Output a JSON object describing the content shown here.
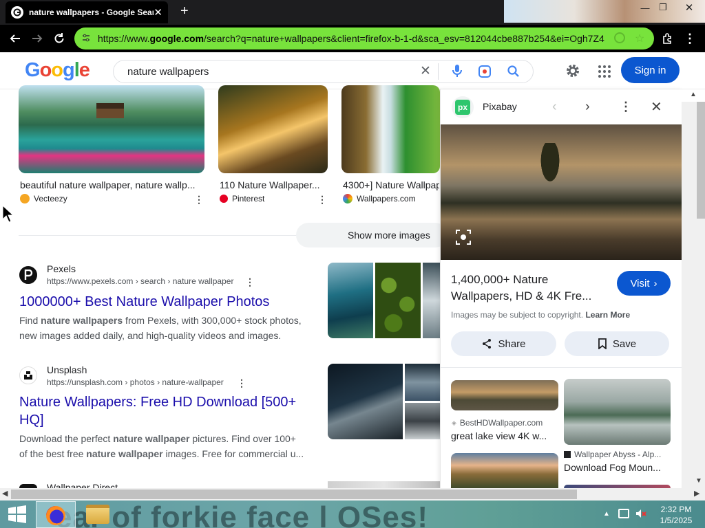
{
  "browser": {
    "tab_title": "nature wallpapers - Google Search",
    "url_prefix": "https://www.",
    "url_domain": "google.com",
    "url_rest": "/search?q=nature+wallpapers&client=firefox-b-1-d&sca_esv=812044cbe887b254&ei=Ogh7Z4"
  },
  "google": {
    "logo_letters": [
      "G",
      "o",
      "o",
      "g",
      "l",
      "e"
    ],
    "logo_colors": [
      "#4285f4",
      "#ea4335",
      "#fbbc05",
      "#4285f4",
      "#34a853",
      "#ea4335"
    ],
    "query": "nature wallpapers",
    "signin": "Sign in"
  },
  "images": {
    "items": [
      {
        "caption": "beautiful nature wallpaper, nature wallp...",
        "source": "Vecteezy",
        "source_color": "#f5a623"
      },
      {
        "caption": "110 Nature Wallpaper...",
        "source": "Pinterest",
        "source_color": "#e60023"
      },
      {
        "caption": "4300+] Nature Wallpap",
        "source": "Wallpapers.com",
        "source_color": "#6b8cff"
      }
    ],
    "show_more": "Show more images"
  },
  "results": [
    {
      "site": "Pexels",
      "url": "https://www.pexels.com › search › nature wallpaper",
      "title": "1000000+ Best Nature Wallpaper Photos",
      "snip1_a": "Find ",
      "snip1_b": "nature wallpapers",
      "snip1_c": " from Pexels, with 300,000+ stock photos,",
      "snip2": "new images added daily, and high-quality videos and images."
    },
    {
      "site": "Unsplash",
      "url": "https://unsplash.com › photos › nature-wallpaper",
      "title1": "Nature Wallpapers: Free HD Download [500+",
      "title2": "HQ]",
      "snip1_a": "Download the perfect ",
      "snip1_b": "nature wallpaper",
      "snip1_c": " pictures. Find over 100+",
      "snip2_a": "of the best free ",
      "snip2_b": "nature wallpaper",
      "snip2_c": " images. Free for commercial u..."
    },
    {
      "site": "Wallpaper Direct"
    }
  ],
  "panel": {
    "source": "Pixabay",
    "title1": "1,400,000+ Nature",
    "title2": "Wallpapers, HD & 4K Fre...",
    "visit": "Visit",
    "copyright": "Images may be subject to copyright.",
    "learn_more": "Learn More",
    "share": "Share",
    "save": "Save",
    "related": [
      {
        "source": "BestHDWallpaper.com",
        "caption": "great lake view 4K w..."
      },
      {
        "source": "Wallpaper Abyss - Alp...",
        "caption": "Download Fog Moun..."
      }
    ]
  },
  "taskbar": {
    "wallpaper_text": "ear of forkie face   l OSes!",
    "time": "2:32 PM",
    "date": "1/5/2025"
  }
}
